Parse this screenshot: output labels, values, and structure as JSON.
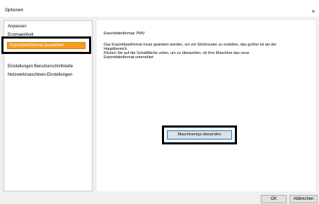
{
  "window": {
    "title": "Optionen",
    "close_symbol": "×"
  },
  "sidebar": {
    "items": [
      {
        "label": "Anpassen"
      },
      {
        "label": "Erstmaeinheit"
      },
      {
        "label": "Exportdateiformat auswählen",
        "selected": true
      },
      {
        "label": "Einstellungen Benutzerschnittstelle"
      },
      {
        "label": "Netzwerkmaschinen-Einstellungen"
      }
    ]
  },
  "main": {
    "format_line": "Exportdateiformat: PMV",
    "description_lines": [
      "Das Exportdateiformat muss geändert werden, um ein Stickmuster zu erstellen, das größer ist als der",
      "Hauptbereich.",
      "Klicken Sie auf die Schaltfläche unten, um zu überprüfen, ob Ihre Maschine das neue",
      "Exportdateiformat unterstützt."
    ],
    "check_button_label": "Maschinentyp überprüfen"
  },
  "footer": {
    "ok_label": "OK",
    "cancel_label": "Abbrechen"
  },
  "colors": {
    "selection": "#f79c1e",
    "highlight_frame": "#000000"
  }
}
